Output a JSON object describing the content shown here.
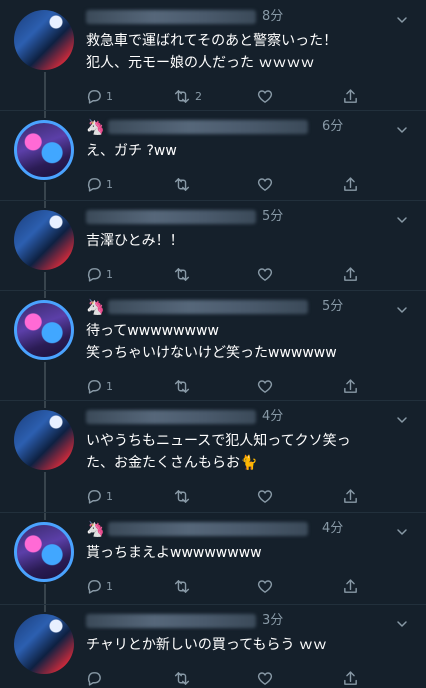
{
  "colors": {
    "background": "#15202b",
    "text": "#ffffff",
    "muted": "#8899a6",
    "divider": "#22303c"
  },
  "tweets": [
    {
      "time": "8分",
      "text": "救急車で運ばれてそのあと警察いった！\n犯人、元モー娘の人だった ｗｗｗｗ",
      "reply_count": "1",
      "retweet_count": "2",
      "avatar": "style-a",
      "badge": ""
    },
    {
      "time": "6分",
      "text": "え、ガチ ?ww",
      "reply_count": "1",
      "retweet_count": "",
      "avatar": "style-b",
      "badge": "🦄"
    },
    {
      "time": "5分",
      "text": "吉澤ひとみ！！",
      "reply_count": "1",
      "retweet_count": "",
      "avatar": "style-a",
      "badge": ""
    },
    {
      "time": "5分",
      "text": "待ってwwwwwwww\n笑っちゃいけないけど笑ったwwwwww",
      "reply_count": "1",
      "retweet_count": "",
      "avatar": "style-b",
      "badge": "🦄"
    },
    {
      "time": "4分",
      "text": "いやうちもニュースで犯人知ってクソ笑っ\nた、お金たくさんもらお🐈",
      "reply_count": "1",
      "retweet_count": "",
      "avatar": "style-a",
      "badge": ""
    },
    {
      "time": "4分",
      "text": "貰っちまえよwwwwwwww",
      "reply_count": "1",
      "retweet_count": "",
      "avatar": "style-b",
      "badge": "🦄"
    },
    {
      "time": "3分",
      "text": "チャリとか新しいの買ってもらう ｗｗ",
      "reply_count": "",
      "retweet_count": "",
      "avatar": "style-a",
      "badge": ""
    }
  ],
  "icons": {
    "reply": "reply-icon",
    "retweet": "retweet-icon",
    "like": "heart-icon",
    "share": "share-icon",
    "menu": "chevron-down-icon"
  }
}
